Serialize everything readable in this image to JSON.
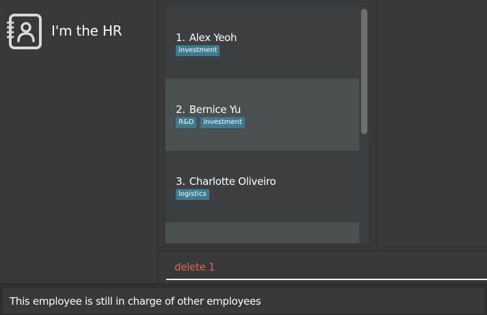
{
  "app": {
    "title": "I'm the HR",
    "icon": "address-book-icon"
  },
  "employees": [
    {
      "index": "1.",
      "name": "Alex Yeoh",
      "tags": [
        "investment"
      ]
    },
    {
      "index": "2.",
      "name": "Bernice Yu",
      "tags": [
        "R&D",
        "investment"
      ]
    },
    {
      "index": "3.",
      "name": "Charlotte Oliveiro",
      "tags": [
        "logistics"
      ]
    }
  ],
  "command": {
    "value": "delete 1",
    "color": "#e0694f"
  },
  "result": {
    "message": "This employee is still in charge of other employees"
  },
  "colors": {
    "background": "#383838",
    "card_odd": "#3c3f41",
    "card_even": "#4b5052",
    "tag": "#3e7b91"
  }
}
